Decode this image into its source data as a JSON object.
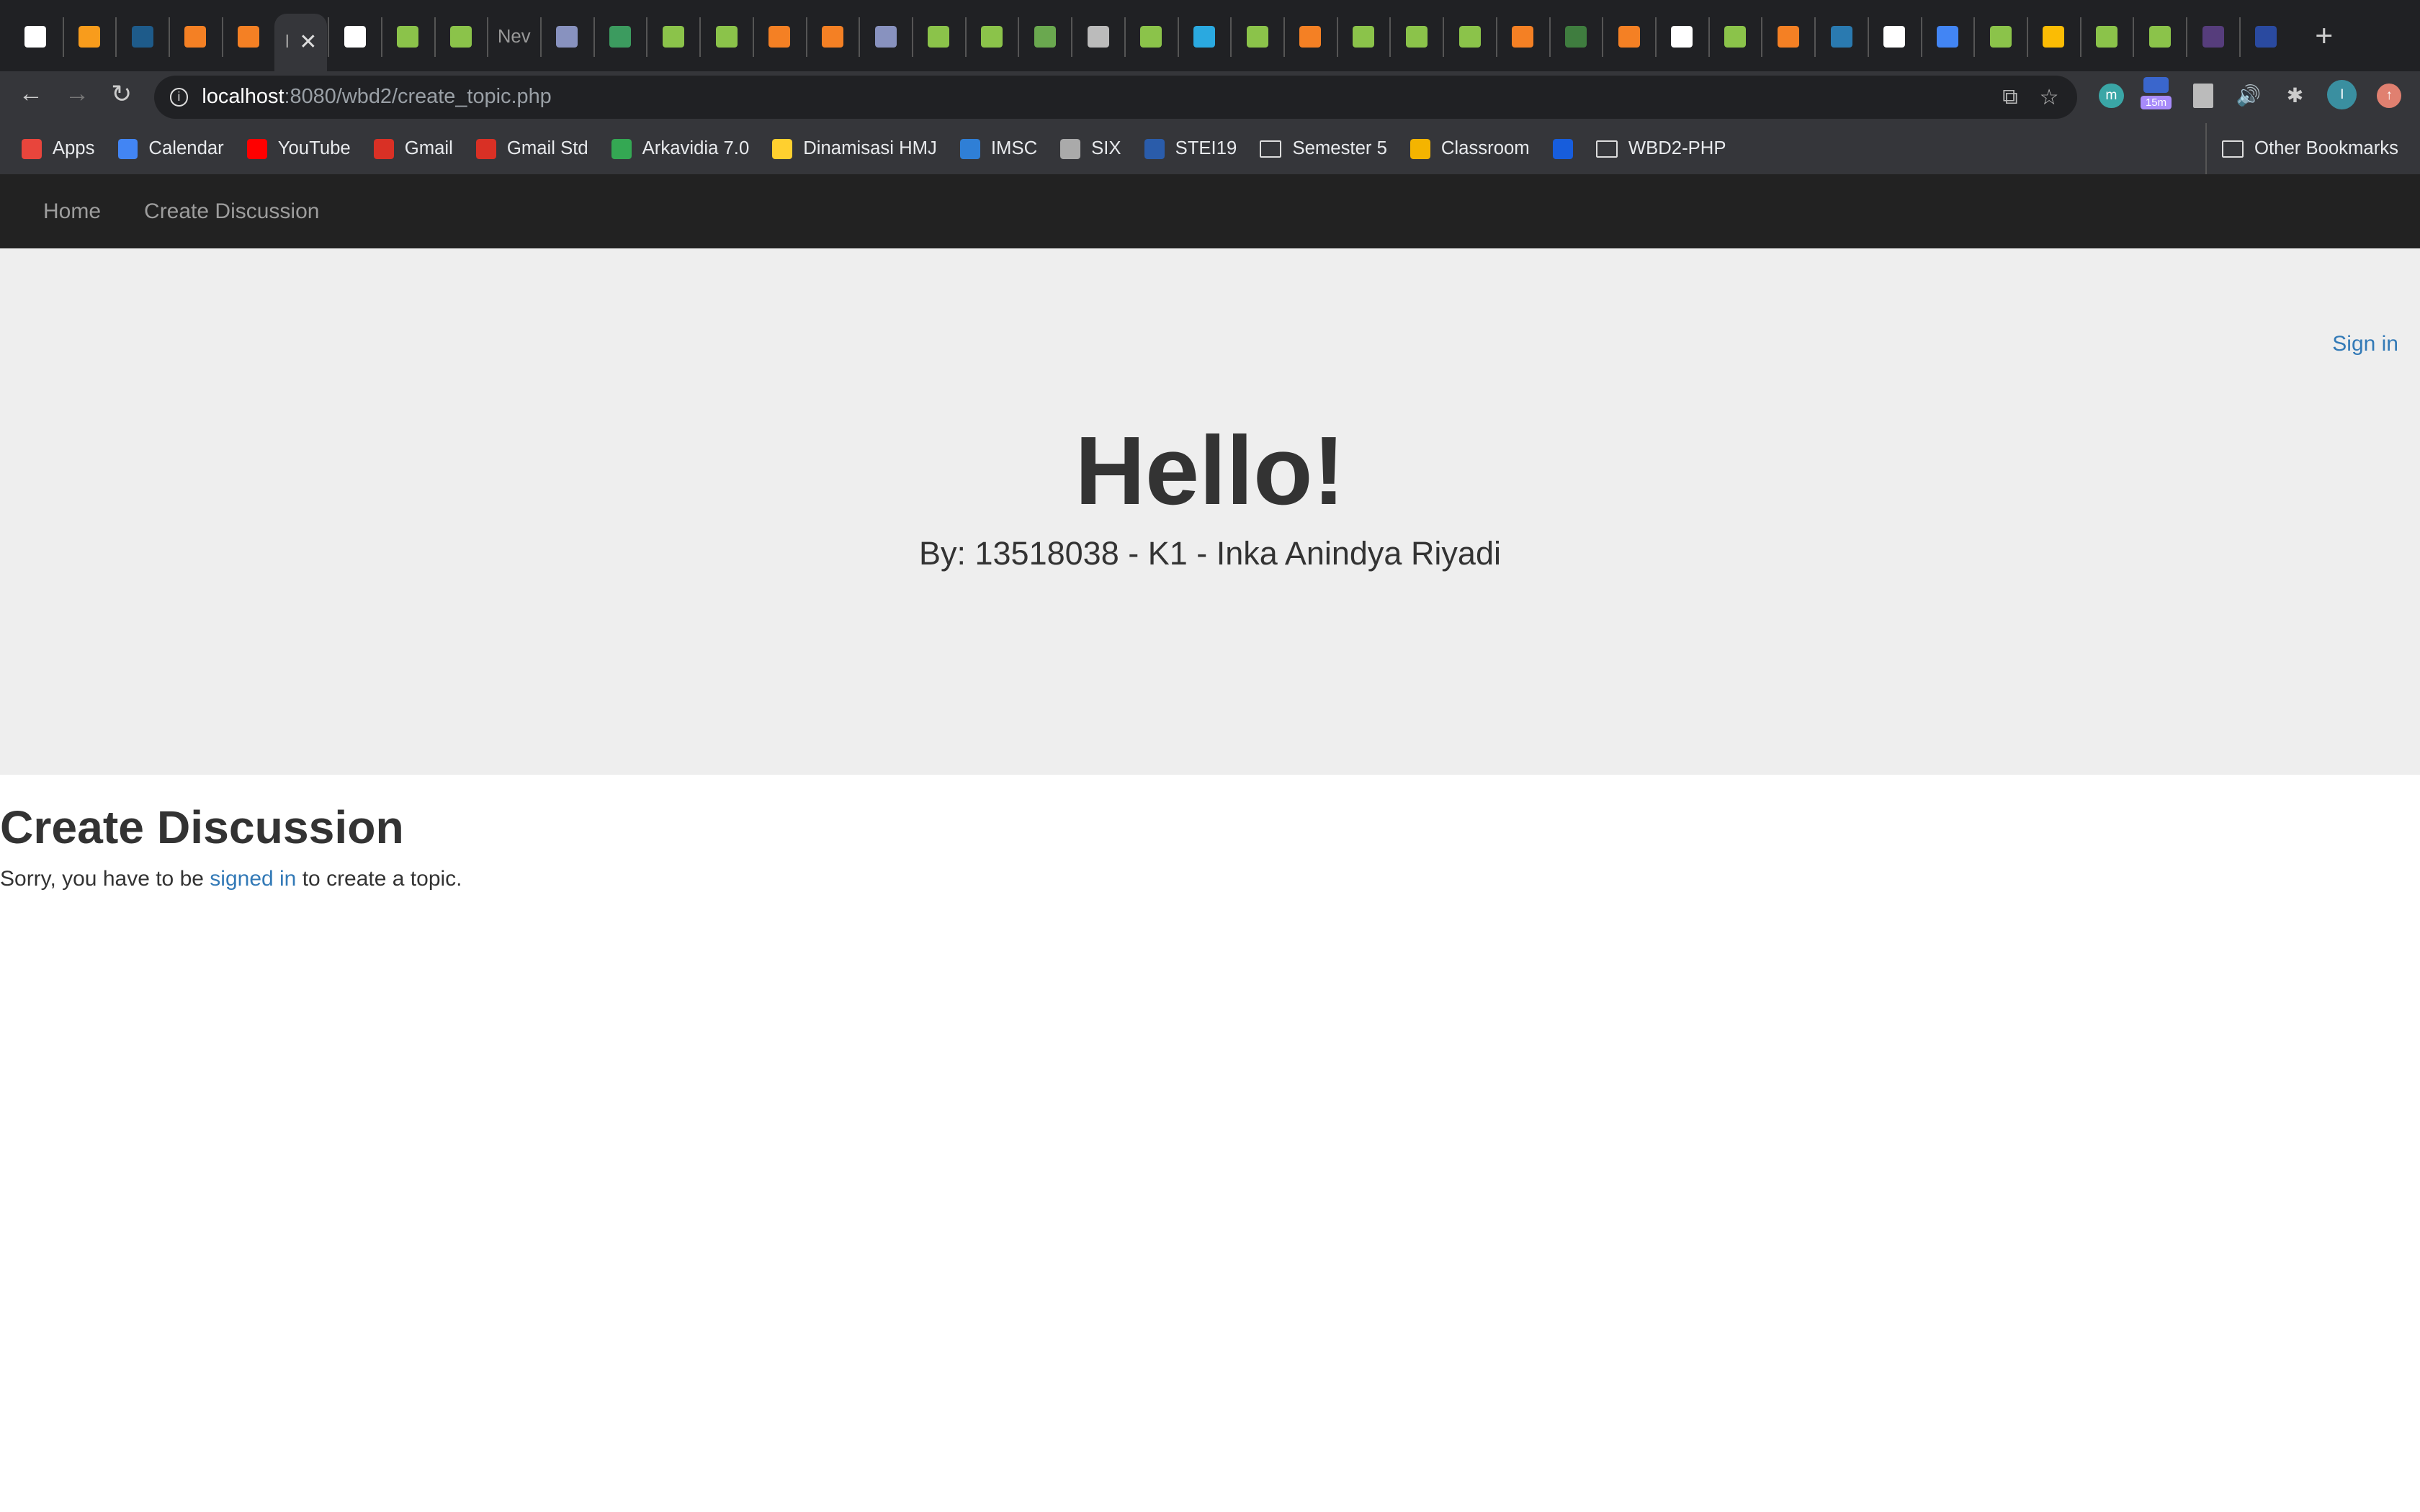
{
  "browser": {
    "tabs": [
      {
        "icon": "diamond-icon",
        "color": "#ffffff"
      },
      {
        "icon": "pma-icon",
        "color": "#f89c1c"
      },
      {
        "icon": "mysql-icon",
        "color": "#1e5b8a"
      },
      {
        "icon": "stackoverflow-icon",
        "color": "#f48024"
      },
      {
        "icon": "stackoverflow-icon",
        "color": "#f48024"
      },
      {
        "icon": "active-tab",
        "color": "",
        "label": "I",
        "active": true
      },
      {
        "icon": "diamond-icon",
        "color": "#ffffff"
      },
      {
        "icon": "w3schools-icon",
        "color": "#8bc34a"
      },
      {
        "icon": "w3schools-icon",
        "color": "#8bc34a"
      },
      {
        "icon": "text",
        "color": "",
        "label": "Nev"
      },
      {
        "icon": "php-icon",
        "color": "#8892bf"
      },
      {
        "icon": "sheets-icon",
        "color": "#3c9b5f"
      },
      {
        "icon": "w3schools-icon",
        "color": "#8bc34a"
      },
      {
        "icon": "w3schools-icon",
        "color": "#8bc34a"
      },
      {
        "icon": "stackoverflow-icon",
        "color": "#f48024"
      },
      {
        "icon": "stackoverflow-icon",
        "color": "#f48024"
      },
      {
        "icon": "php-icon",
        "color": "#8892bf"
      },
      {
        "icon": "w3schools-icon",
        "color": "#8bc34a"
      },
      {
        "icon": "w3schools-icon",
        "color": "#8bc34a"
      },
      {
        "icon": "leaf-icon",
        "color": "#6aa84f"
      },
      {
        "icon": "printer-icon",
        "color": "#bbbbbb"
      },
      {
        "icon": "w3schools-icon",
        "color": "#8bc34a"
      },
      {
        "icon": "house-icon",
        "color": "#2aa9e0"
      },
      {
        "icon": "w3schools-icon",
        "color": "#8bc34a"
      },
      {
        "icon": "stackoverflow-icon",
        "color": "#f48024"
      },
      {
        "icon": "w3schools-icon",
        "color": "#8bc34a"
      },
      {
        "icon": "w3schools-icon",
        "color": "#8bc34a"
      },
      {
        "icon": "w3schools-icon",
        "color": "#8bc34a"
      },
      {
        "icon": "stackoverflow-icon",
        "color": "#f48024"
      },
      {
        "icon": "green-icon",
        "color": "#3f7d3f"
      },
      {
        "icon": "stackoverflow-icon",
        "color": "#f48024"
      },
      {
        "icon": "google-icon",
        "color": "#ffffff"
      },
      {
        "icon": "w3schools-icon",
        "color": "#8bc34a"
      },
      {
        "icon": "stackoverflow-icon",
        "color": "#f48024"
      },
      {
        "icon": "swirl-icon",
        "color": "#2a7ab0"
      },
      {
        "icon": "google-icon",
        "color": "#ffffff"
      },
      {
        "icon": "docs-icon",
        "color": "#4285f4"
      },
      {
        "icon": "w3schools-icon",
        "color": "#8bc34a"
      },
      {
        "icon": "drive-icon",
        "color": "#fbbc04"
      },
      {
        "icon": "w3schools-icon",
        "color": "#8bc34a"
      },
      {
        "icon": "w3schools-icon",
        "color": "#8bc34a"
      },
      {
        "icon": "bootstrap-icon",
        "color": "#563d7c"
      },
      {
        "icon": "blue-icon",
        "color": "#2a4aa0"
      }
    ],
    "address": {
      "host": "localhost",
      "path": ":8080/wbd2/create_topic.php"
    },
    "extension_badge": "15m",
    "profile_initial": "I",
    "bookmarks": [
      {
        "label": "Apps",
        "icon": "apps-icon",
        "color": "#e8453c"
      },
      {
        "label": "Calendar",
        "icon": "calendar-icon",
        "color": "#4285f4"
      },
      {
        "label": "YouTube",
        "icon": "youtube-icon",
        "color": "#ff0000"
      },
      {
        "label": "Gmail",
        "icon": "gmail-icon",
        "color": "#d93025"
      },
      {
        "label": "Gmail Std",
        "icon": "gmail-icon",
        "color": "#d93025"
      },
      {
        "label": "Arkavidia 7.0",
        "icon": "drive-icon",
        "color": "#34a853"
      },
      {
        "label": "Dinamisasi HMJ",
        "icon": "miro-icon",
        "color": "#ffd02f"
      },
      {
        "label": "IMSC",
        "icon": "onedrive-icon",
        "color": "#2f7fd6"
      },
      {
        "label": "SIX",
        "icon": "six-icon",
        "color": "#aaaaaa"
      },
      {
        "label": "STEI19",
        "icon": "itb-icon",
        "color": "#2a5caa"
      },
      {
        "label": "Semester 5",
        "icon": "folder-icon",
        "color": ""
      },
      {
        "label": "Classroom",
        "icon": "classroom-icon",
        "color": "#f4b400"
      },
      {
        "label": "",
        "icon": "bitwarden-icon",
        "color": "#175ddc"
      },
      {
        "label": "WBD2-PHP",
        "icon": "folder-icon",
        "color": ""
      }
    ],
    "other_bookmarks": "Other Bookmarks"
  },
  "site": {
    "nav": [
      "Home",
      "Create Discussion"
    ],
    "sign_in": "Sign in",
    "hero_title": "Hello!",
    "hero_subtitle": "By: 13518038 - K1 - Inka Anindya Riyadi",
    "section_title": "Create Discussion",
    "message_before": "Sorry, you have to be ",
    "message_link": "signed in",
    "message_after": " to create a topic."
  }
}
